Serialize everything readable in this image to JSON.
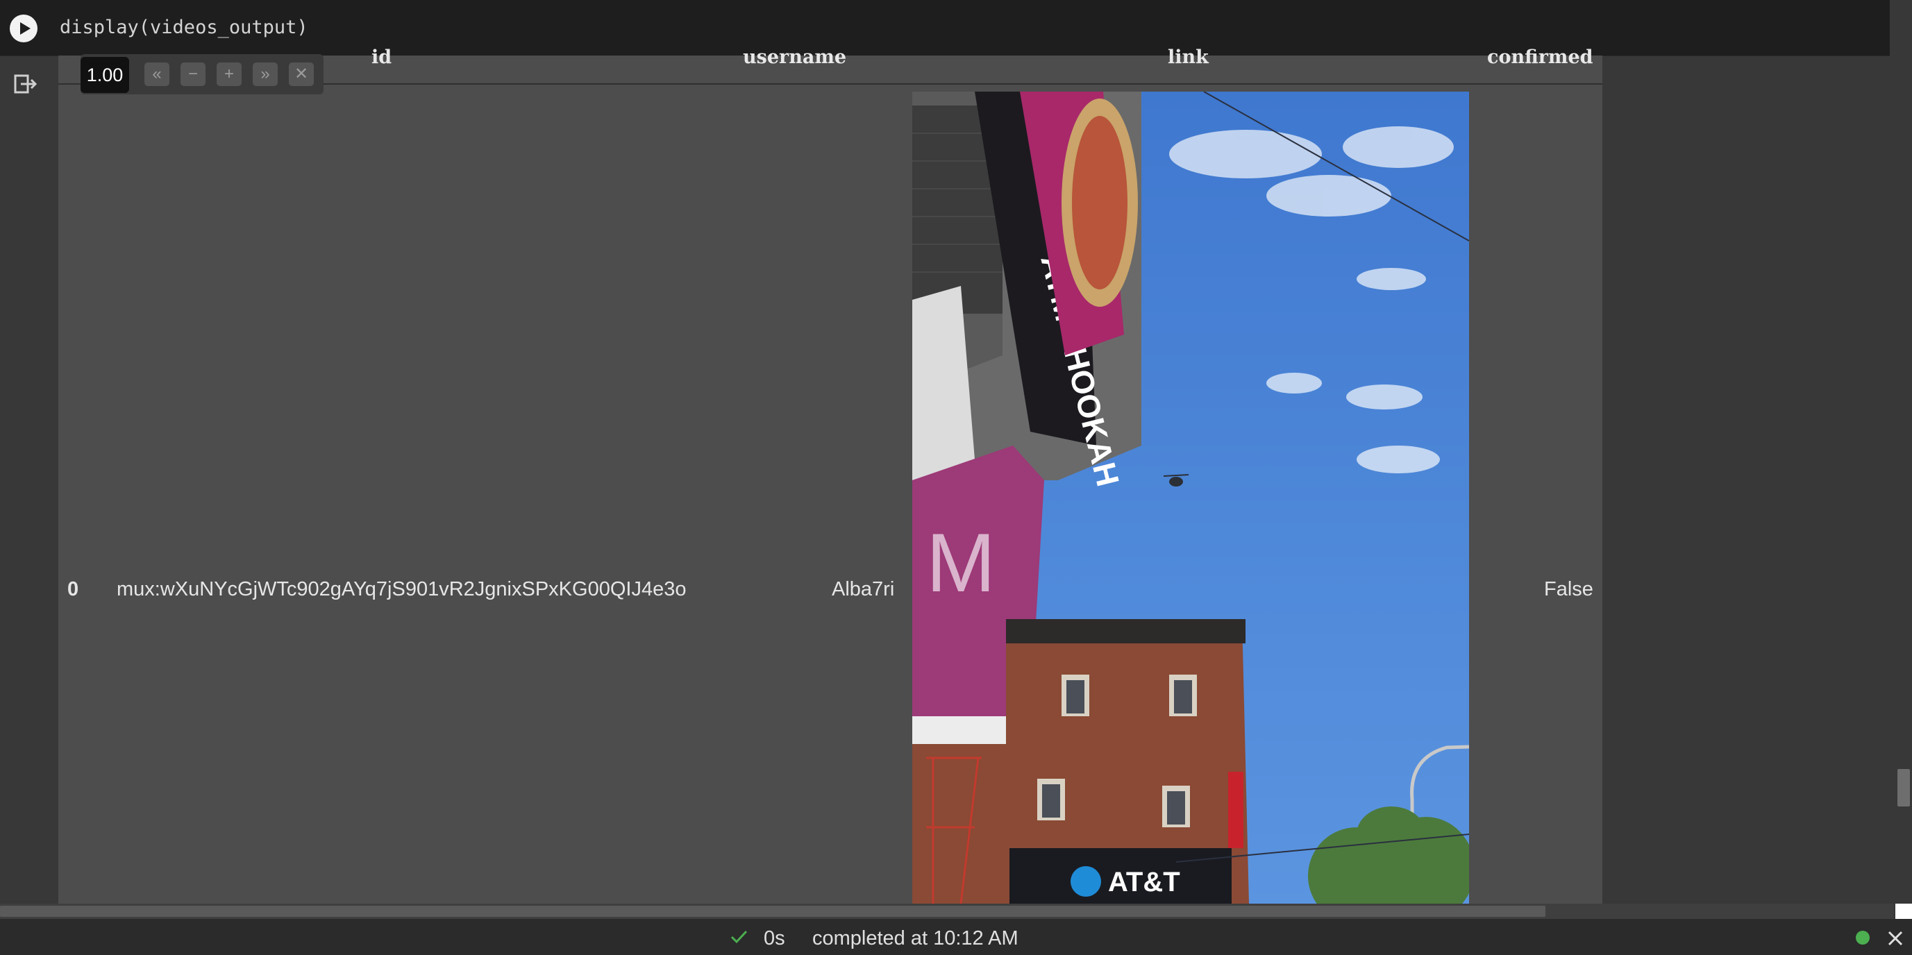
{
  "code_cell": {
    "code": "display(videos_output)"
  },
  "table": {
    "headers": [
      "id",
      "username",
      "link",
      "confirmed"
    ],
    "rows": [
      {
        "index": "0",
        "id": "mux:wXuNYcGjWTc902gAYq7jS901vR2JgnixSPxKG00QIJ4e3o",
        "username": "Alba7ri",
        "confirmed": "False"
      }
    ]
  },
  "pager": {
    "value": "1.00",
    "buttons": [
      "«",
      "−",
      "+",
      "»",
      "✕"
    ]
  },
  "video_signs": {
    "shop_sign": "ATM · HOOKAH",
    "brand_sign": "AT&T"
  },
  "status": {
    "duration": "0s",
    "message": "completed at 10:12 AM"
  },
  "colors": {
    "status_ok": "#4caf50",
    "sky": "#4a86d6",
    "brick": "#8a4a35",
    "awning": "#b0306e"
  },
  "icons": [
    "play-icon",
    "output-exit-icon",
    "check-icon",
    "close-icon"
  ]
}
